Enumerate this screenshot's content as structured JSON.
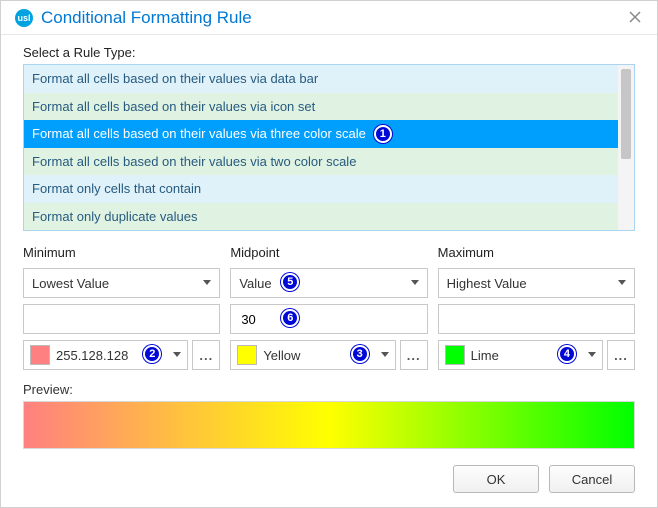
{
  "window": {
    "title": "Conditional Formatting Rule",
    "logo_text": "usl"
  },
  "labels": {
    "select_rule_type": "Select a Rule Type:",
    "minimum": "Minimum",
    "midpoint": "Midpoint",
    "maximum": "Maximum",
    "preview": "Preview:"
  },
  "rule_types": {
    "items": [
      "Format all cells based on their values via data bar",
      "Format all cells based on their values via icon set",
      "Format all cells based on their values via three color scale",
      "Format all cells based on their values via two color scale",
      "Format only cells that contain",
      "Format only duplicate values"
    ],
    "selected_index": 2
  },
  "minimum": {
    "type": "Lowest Value",
    "value": "",
    "color_label": "255.128.128",
    "color_hex": "#ff8080"
  },
  "midpoint": {
    "type": "Value",
    "value": "30",
    "color_label": "Yellow",
    "color_hex": "#ffff00"
  },
  "maximum": {
    "type": "Highest Value",
    "value": "",
    "color_label": "Lime",
    "color_hex": "#00ff00"
  },
  "buttons": {
    "ok": "OK",
    "cancel": "Cancel"
  },
  "callouts": {
    "c1": "1",
    "c2": "2",
    "c3": "3",
    "c4": "4",
    "c5": "5",
    "c6": "6"
  },
  "glyph": {
    "more": "..."
  }
}
